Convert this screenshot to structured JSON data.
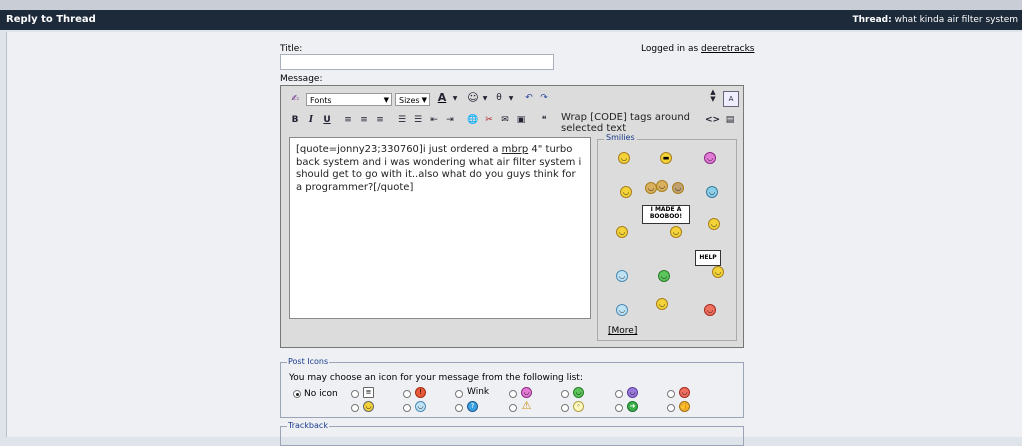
{
  "titlebar": {
    "left": "Reply to Thread",
    "thread_label": "Thread:",
    "thread_title": "what kinda air filter system"
  },
  "form": {
    "title_label": "Title:",
    "message_label": "Message:",
    "logged_in_text": "Logged in as",
    "username": "deeretracks"
  },
  "toolbar": {
    "font_select": "Fonts",
    "size_select": "Sizes",
    "wrap_code_label": "Wrap [CODE] tags around selected text",
    "bold": "B",
    "italic": "I",
    "underline": "U"
  },
  "message_text": {
    "part1": "[quote=jonny23;330760]i just ordered a ",
    "link": "mbrp",
    "part2": " 4\" turbo back system and i was wondering what air filter system i should get to go with it..also what do you guys think for a programmer?[/quote]"
  },
  "smilies": {
    "legend": "Smilies",
    "more": "[More]",
    "sign1": "I MADE A BOOBOO!",
    "sign2": "HELP"
  },
  "post_icons": {
    "legend": "Post Icons",
    "instructions": "You may choose an icon for your message from the following list:",
    "no_icon": "No icon",
    "wink": "Wink"
  },
  "trackback": {
    "legend": "Trackback"
  },
  "colors": {
    "titlebar": "#1d2a3a",
    "accent": "#1a3a8a",
    "smiley": "#f3d23a"
  }
}
